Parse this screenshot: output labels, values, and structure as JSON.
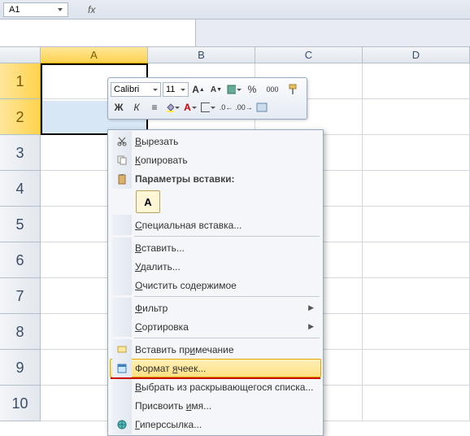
{
  "name_box": {
    "value": "A1"
  },
  "formula_bar": {
    "fx_label": "fx",
    "value": ""
  },
  "columns": [
    "A",
    "B",
    "C",
    "D"
  ],
  "rows": [
    "1",
    "2",
    "3",
    "4",
    "5",
    "6",
    "7",
    "8",
    "9",
    "10"
  ],
  "selected_columns": [
    "A"
  ],
  "selected_rows": [
    "1",
    "2"
  ],
  "active_cell": "A1",
  "mini_toolbar": {
    "font_name": "Calibri",
    "font_size": "11",
    "row1_icons": [
      "grow-font",
      "shrink-font",
      "accounting-format",
      "percent",
      "comma-style",
      "format-painter"
    ],
    "row1_labels": {
      "grow": "A",
      "shrink": "A",
      "percent": "%",
      "comma": "000"
    },
    "row2": {
      "bold": "Ж",
      "italic": "К",
      "align": "≡",
      "icons": [
        "bold",
        "italic",
        "align-center",
        "fill-color",
        "font-color",
        "borders",
        "increase-decimal",
        "decrease-decimal",
        "merge"
      ]
    }
  },
  "context_menu": {
    "cut": "Вырезать",
    "copy": "Копировать",
    "paste_options_label": "Параметры вставки:",
    "paste_option_a": "А",
    "paste_special": "Специальная вставка...",
    "insert": "Вставить...",
    "delete": "Удалить...",
    "clear_contents": "Очистить содержимое",
    "filter": "Фильтр",
    "sort": "Сортировка",
    "insert_comment": "Вставить примечание",
    "format_cells": "Формат ячеек...",
    "pick_from_list": "Выбрать из раскрывающегося списка...",
    "define_name": "Присвоить имя...",
    "hyperlink": "Гиперссылка...",
    "accel": {
      "cut": "В",
      "copy": "К",
      "paste_special": "С",
      "insert": "В",
      "delete": "У",
      "clear": "О",
      "filter": "Ф",
      "sort": "С",
      "comment": "и",
      "format": "я",
      "pick": "В",
      "name": "и",
      "hyperlink": "Г"
    }
  }
}
